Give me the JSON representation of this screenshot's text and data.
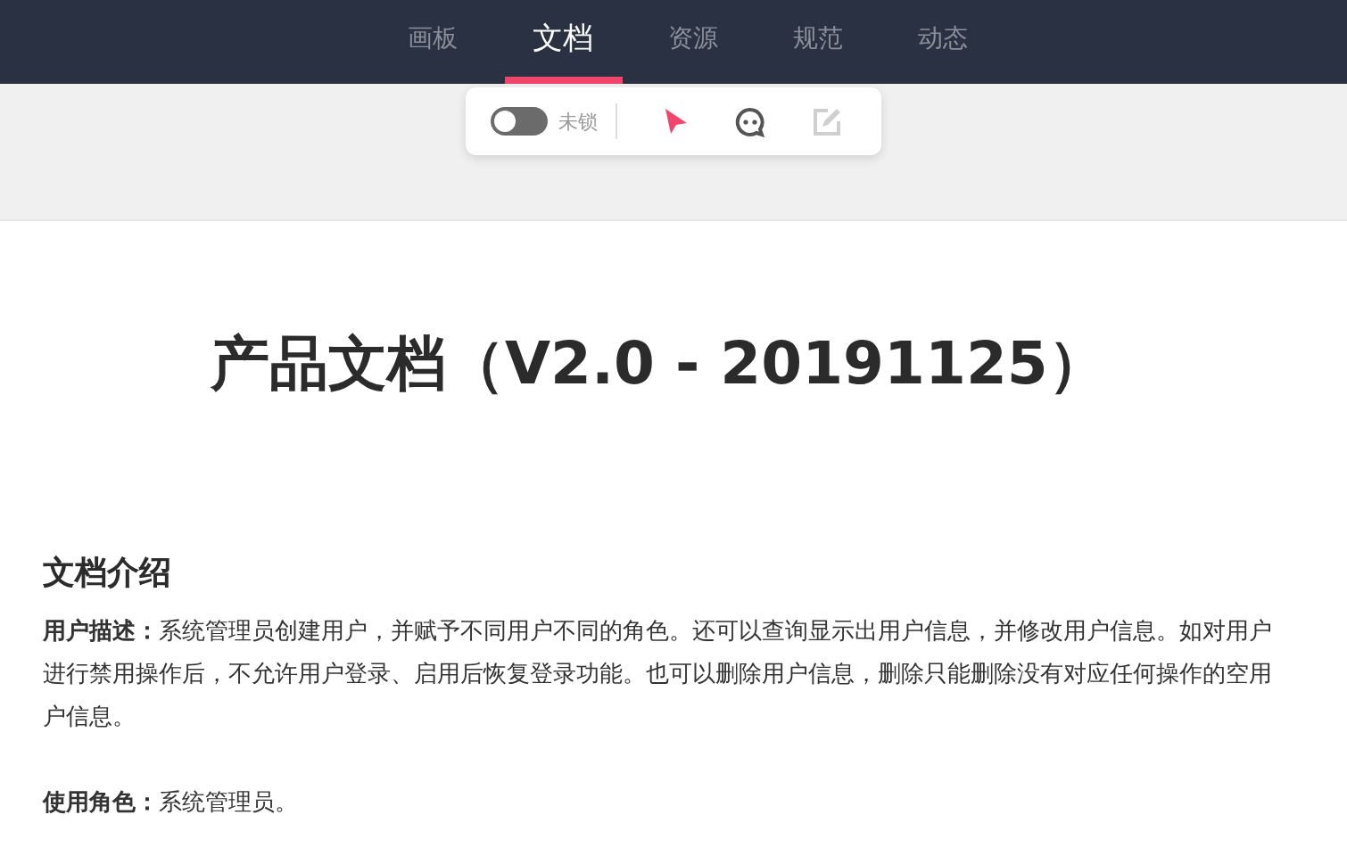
{
  "nav": {
    "tabs": [
      {
        "label": "画板",
        "selected": false
      },
      {
        "label": "文档",
        "selected": true
      },
      {
        "label": "资源",
        "selected": false
      },
      {
        "label": "规范",
        "selected": false
      },
      {
        "label": "动态",
        "selected": false
      }
    ]
  },
  "toolbar": {
    "lock": {
      "on": false,
      "label": "未锁"
    },
    "tools": [
      {
        "kind": "pointer",
        "selected": true,
        "disabled": false
      },
      {
        "kind": "comment",
        "selected": false,
        "disabled": false
      },
      {
        "kind": "edit",
        "selected": false,
        "disabled": true
      }
    ]
  },
  "document": {
    "title": "产品文档（V2.0 - 20191125）",
    "section": "文档介绍",
    "paragraphs": [
      "**用户描述：**系统管理员创建用户，并赋予不同用户不同的角色。还可以查询显示出用户信息，并修改用户信息。如对用户进行禁用操作后，不允许用户登录、启用后恢复登录功能。也可以删除用户信息，删除只能删除没有对应任何操作的空用户信息。",
      "**使用角色：**系统管理员。"
    ]
  }
}
